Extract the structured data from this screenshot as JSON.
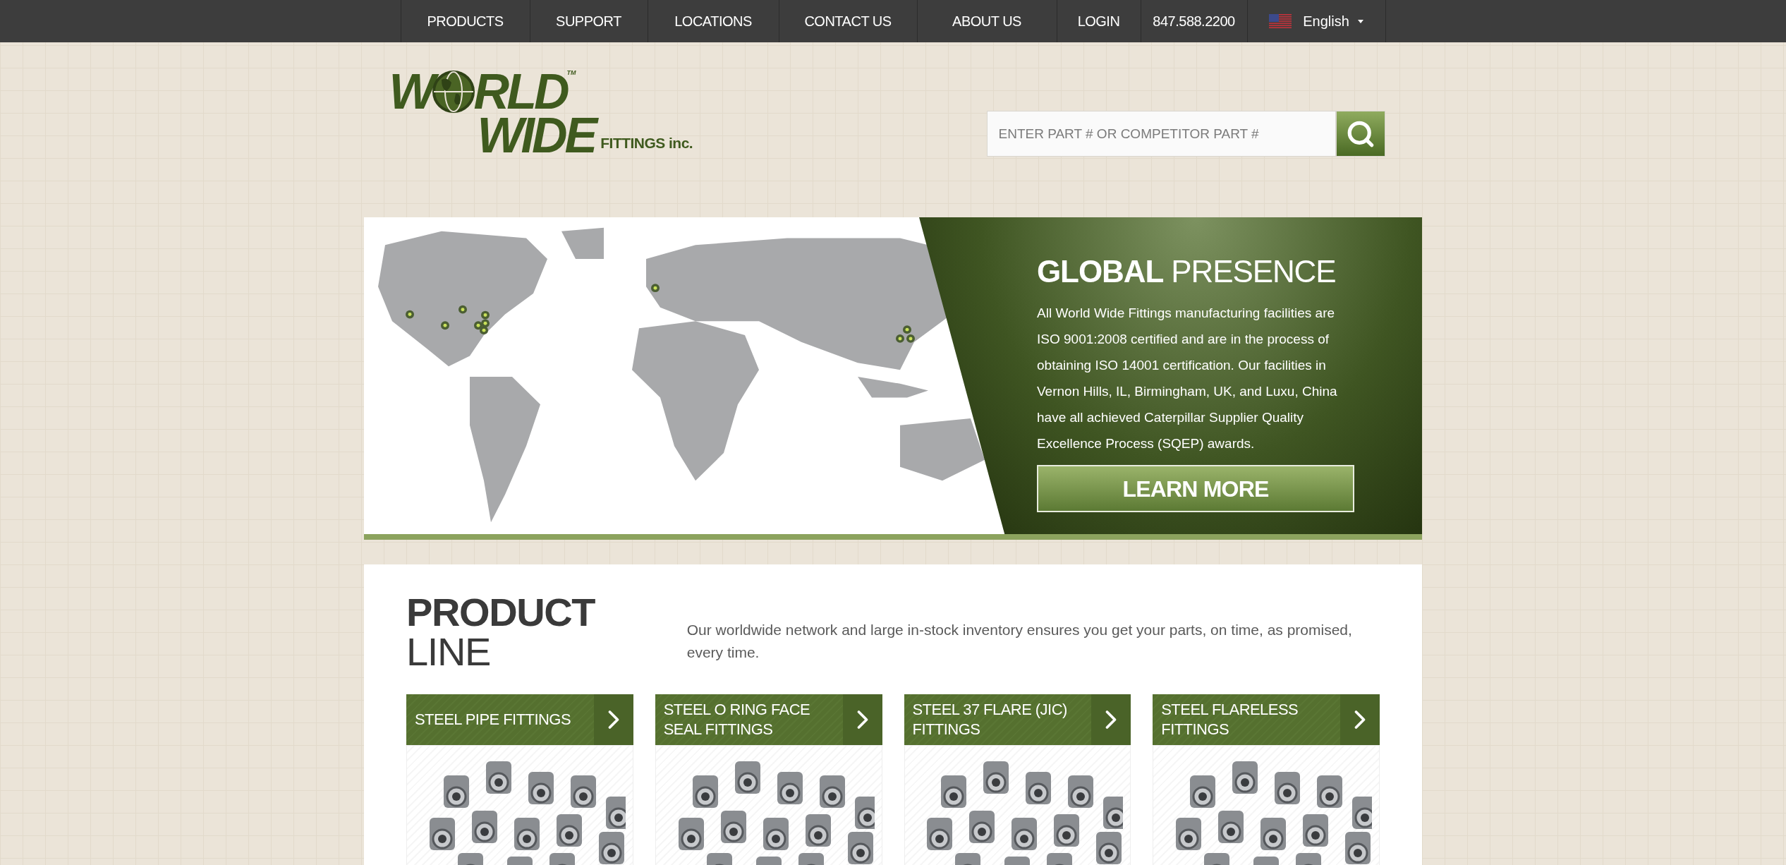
{
  "nav": {
    "items": [
      {
        "label": "PRODUCTS"
      },
      {
        "label": "SUPPORT"
      },
      {
        "label": "LOCATIONS"
      },
      {
        "label": "CONTACT US"
      },
      {
        "label": "ABOUT US"
      },
      {
        "label": "LOGIN"
      },
      {
        "label": "847.588.2200"
      }
    ],
    "language": "English"
  },
  "logo": {
    "line_1_start": "W",
    "line_1_end": "RLD",
    "trademark": "TM",
    "line_2": "WIDE",
    "suffix": "FITTINGS inc."
  },
  "search": {
    "placeholder": "ENTER PART # OR COMPETITOR PART #"
  },
  "banner": {
    "title_bold": "GLOBAL",
    "title_light": "PRESENCE",
    "text": "All World Wide Fittings manufacturing facilities are ISO 9001:2008 certified and are in the process of obtaining ISO 14001 certification. Our facilities in Vernon Hills, IL, Birmingham, UK, and Luxu, China have all achieved Caterpillar Supplier Quality Excellence Process (SQEP) awards.",
    "button": "LEARN MORE"
  },
  "product_line": {
    "title_bold": "PRODUCT",
    "title_light": "LINE",
    "tagline": "Our worldwide network and large in-stock inventory ensures you get your parts, on time, as promised, every time.",
    "cards": [
      {
        "title": "STEEL PIPE FITTINGS"
      },
      {
        "title": "STEEL O RING FACE SEAL FITTINGS"
      },
      {
        "title": "STEEL 37 FLARE (JIC) FITTINGS"
      },
      {
        "title": "STEEL FLARELESS FITTINGS"
      }
    ]
  }
}
